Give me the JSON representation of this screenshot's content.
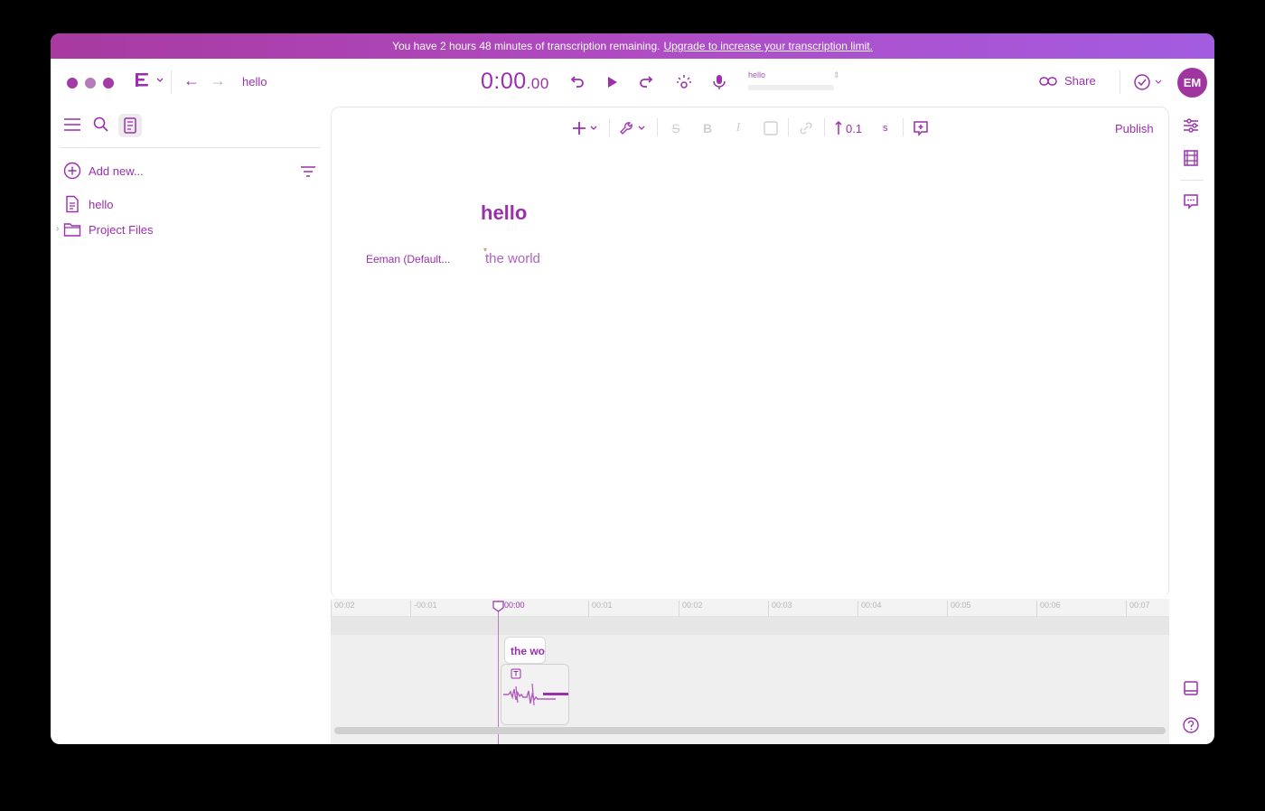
{
  "banner": {
    "text": "You have 2 hours 48 minutes of transcription remaining.",
    "link": "Upgrade to increase your transcription limit."
  },
  "titlebar": {
    "doc_title": "hello",
    "timer_main": "0:00",
    "timer_fraction": ".00",
    "mini_doc_title": "hello",
    "share_label": "Share",
    "avatar_initials": "EM"
  },
  "sidebar": {
    "add_new": "Add new...",
    "items": [
      {
        "label": "hello",
        "icon": "document-icon"
      },
      {
        "label": "Project Files",
        "icon": "folder-icon"
      }
    ]
  },
  "editor": {
    "publish_label": "Publish",
    "gap_value": "0.1",
    "gap_unit": "s",
    "doc_heading": "hello",
    "speaker": "Eeman (Default...",
    "paragraph": "the world"
  },
  "timeline": {
    "ticks": [
      "00:02",
      "-00:01",
      "00:00",
      "00:01",
      "00:02",
      "00:03",
      "00:04",
      "00:05",
      "00:06",
      "00:07"
    ],
    "clip_text": "the world"
  },
  "colors": {
    "accent": "#9b2fae",
    "banner_start": "#a83aa0",
    "banner_end": "#a35ce0"
  }
}
